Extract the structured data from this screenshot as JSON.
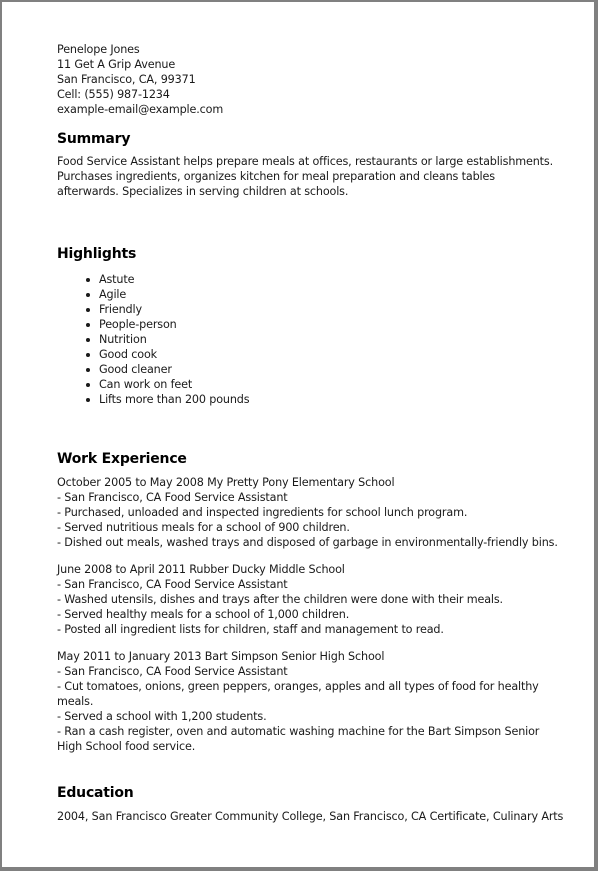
{
  "contact": {
    "name": "Penelope Jones",
    "street": "11 Get A Grip Avenue",
    "city": "San Francisco, CA, 99371",
    "phone": "Cell: (555) 987-1234",
    "email": "example-email@example.com"
  },
  "summary": {
    "heading": "Summary",
    "text": "Food Service Assistant helps prepare meals at offices, restaurants or large establishments. Purchases ingredients, organizes kitchen for meal preparation and cleans tables afterwards. Specializes in serving children at schools."
  },
  "highlights": {
    "heading": "Highlights",
    "items": [
      "Astute",
      "Agile",
      "Friendly",
      "People-person",
      "Nutrition",
      "Good cook",
      "Good cleaner",
      "Can work on feet",
      "Lifts more than 200 pounds"
    ]
  },
  "work_experience": {
    "heading": "Work Experience",
    "jobs": [
      {
        "header": "October 2005 to May 2008 My Pretty Pony Elementary School",
        "location_title": "- San Francisco, CA Food Service Assistant",
        "duties": [
          "- Purchased, unloaded and inspected ingredients for school lunch program.",
          "- Served nutritious meals for a school of 900 children.",
          "- Dished out meals, washed trays and disposed of garbage in environmentally-friendly bins."
        ]
      },
      {
        "header": "June 2008 to April 2011 Rubber Ducky Middle School",
        "location_title": "- San Francisco, CA Food Service Assistant",
        "duties": [
          "- Washed utensils, dishes and trays after the children were done with their meals.",
          "- Served healthy meals for a school of 1,000 children.",
          "- Posted all ingredient lists for children, staff and management to read."
        ]
      },
      {
        "header": "May 2011 to January 2013 Bart Simpson Senior High School",
        "location_title": "- San Francisco, CA Food Service Assistant",
        "duties": [
          "- Cut tomatoes, onions, green peppers, oranges, apples and all types of food for healthy meals.",
          "- Served a school with 1,200 students.",
          "- Ran a cash register, oven and automatic washing machine for the Bart Simpson Senior High School food service."
        ]
      }
    ]
  },
  "education": {
    "heading": "Education",
    "text": "2004, San Francisco Greater Community College, San Francisco, CA Certificate, Culinary Arts"
  }
}
